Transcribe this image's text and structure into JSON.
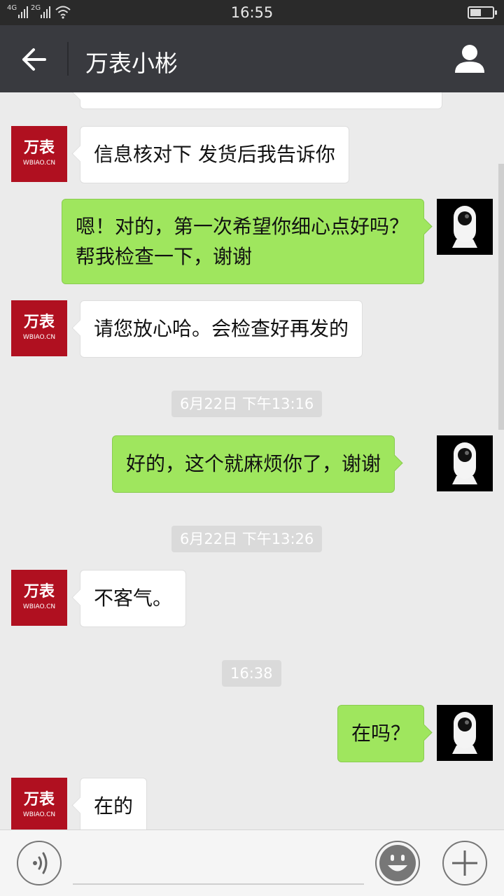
{
  "status_bar": {
    "network_1": "4G",
    "network_2": "2G",
    "time": "16:55",
    "battery_level": 0.5
  },
  "header": {
    "title": "万表小彬"
  },
  "shop_avatar": {
    "brand": "万表",
    "domain": "WBIAO.CN"
  },
  "watermark": "万表",
  "messages": [
    {
      "sender": "shop",
      "text": "信息核对下 发货后我告诉你"
    },
    {
      "sender": "me",
      "text": "嗯！对的，第一次希望你细心点好吗？帮我检查一下，谢谢"
    },
    {
      "sender": "shop",
      "text": "请您放心哈。会检查好再发的"
    },
    {
      "sender": "me",
      "text": "好的，这个就麻烦你了，谢谢"
    },
    {
      "sender": "shop",
      "text": "不客气。"
    },
    {
      "sender": "me",
      "text": "在吗？"
    },
    {
      "sender": "shop",
      "text": "在的"
    }
  ],
  "timestamps": [
    "6月22日 下午13:16",
    "6月22日 下午13:26",
    "16:38"
  ],
  "colors": {
    "titlebar": "#393a3f",
    "outgoing_bubble": "#9fe65e",
    "incoming_bubble": "#ffffff",
    "shop_avatar": "#b01020",
    "background": "#ebebeb"
  },
  "icons": {
    "back": "arrow-left",
    "profile": "person-silhouette",
    "voice": "voice-waves",
    "emoji": "smiley-face",
    "more": "plus"
  }
}
